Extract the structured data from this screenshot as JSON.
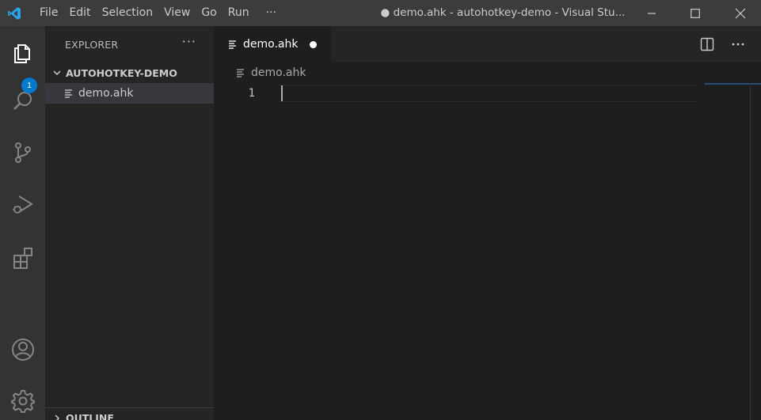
{
  "titlebar": {
    "app_icon": "vscode-logo-icon",
    "menu": [
      "File",
      "Edit",
      "Selection",
      "View",
      "Go",
      "Run",
      "···"
    ],
    "window_title": "● demo.ahk - autohotkey-demo - Visual Stu...",
    "controls": [
      "minimize-icon",
      "maximize-icon",
      "close-icon"
    ]
  },
  "activitybar": {
    "items": [
      "explorer-icon",
      "search-icon",
      "source-control-icon",
      "run-debug-icon",
      "extensions-icon"
    ],
    "bottom": [
      "account-icon",
      "settings-gear-icon"
    ],
    "explorer_badge": "1",
    "accent": "#007acc"
  },
  "sidebar": {
    "title": "EXPLORER",
    "more": "···",
    "folder": "AUTOHOTKEY-DEMO",
    "files": [
      {
        "name": "demo.ahk",
        "selected": true
      }
    ],
    "outline": "OUTLINE"
  },
  "editor": {
    "tab": {
      "label": "demo.ahk",
      "dirty": true
    },
    "actions": [
      "split-editor-icon",
      "more-actions-icon"
    ],
    "breadcrumb": "demo.ahk",
    "lines": [
      {
        "number": "1",
        "text": ""
      }
    ]
  }
}
